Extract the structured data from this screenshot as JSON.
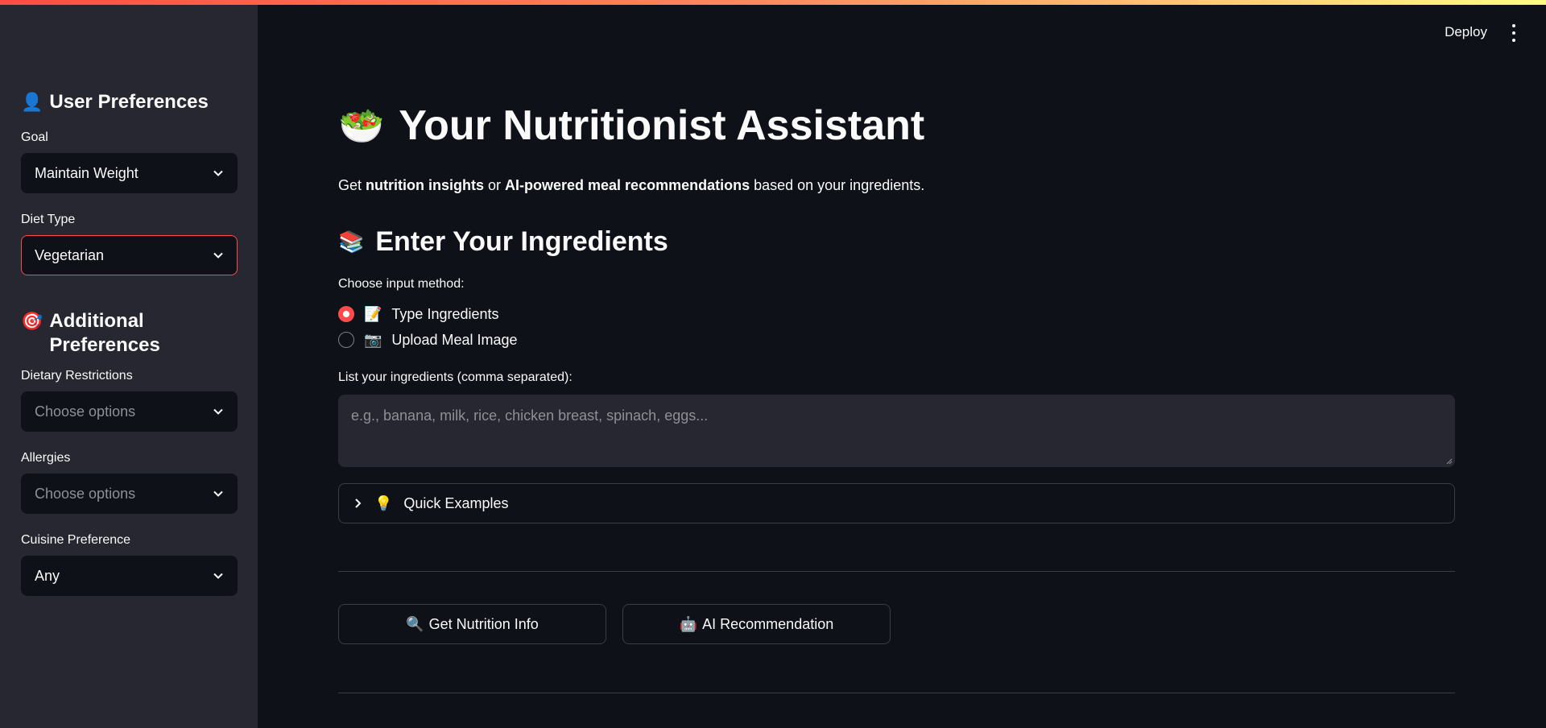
{
  "sidebar": {
    "user_prefs_heading": "User Preferences",
    "goal_label": "Goal",
    "goal_value": "Maintain Weight",
    "diet_label": "Diet Type",
    "diet_value": "Vegetarian",
    "additional_heading": "Additional Preferences",
    "restrictions_label": "Dietary Restrictions",
    "restrictions_placeholder": "Choose options",
    "allergies_label": "Allergies",
    "allergies_placeholder": "Choose options",
    "cuisine_label": "Cuisine Preference",
    "cuisine_value": "Any"
  },
  "header": {
    "deploy_label": "Deploy"
  },
  "main": {
    "title": "Your Nutritionist Assistant",
    "subtitle_parts": {
      "p1": "Get ",
      "b1": "nutrition insights",
      "p2": " or ",
      "b2": "AI-powered meal recommendations",
      "p3": " based on your ingredients."
    },
    "section_heading": "Enter Your Ingredients",
    "input_method_label": "Choose input method:",
    "radio_options": [
      {
        "emoji": "📝",
        "label": "Type Ingredients",
        "checked": true
      },
      {
        "emoji": "📷",
        "label": "Upload Meal Image",
        "checked": false
      }
    ],
    "ingredients_label": "List your ingredients (comma separated):",
    "ingredients_placeholder": "e.g., banana, milk, rice, chicken breast, spinach, eggs...",
    "expander_label": "Quick Examples",
    "buttons": {
      "nutrition": "Get Nutrition Info",
      "ai": "AI Recommendation"
    }
  },
  "icons": {
    "user": "👤",
    "target": "🎯",
    "salad": "🥗",
    "books": "📚",
    "bulb": "💡",
    "magnifier": "🔍",
    "robot": "🤖"
  },
  "colors": {
    "accent": "#ff4b4b",
    "background": "#0e1117",
    "sidebar": "#262730"
  }
}
